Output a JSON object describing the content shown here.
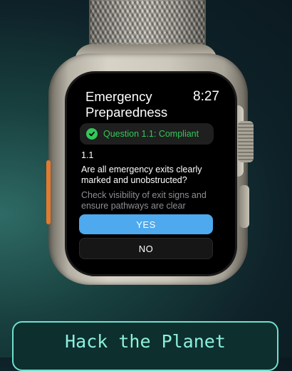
{
  "watch": {
    "title_line1": "Emergency",
    "title_line2": "Preparedness",
    "time": "8:27",
    "status_text": "Question 1.1: Compliant",
    "question_number": "1.1",
    "question_text": "Are all emergency exits clearly marked and unobstructed?",
    "hint_text": "Check visibility of exit signs and ensure pathways are clear",
    "yes_label": "YES",
    "no_label": "NO"
  },
  "banner": {
    "text": "Hack the Planet"
  },
  "colors": {
    "accent_blue": "#4ea9ee",
    "compliant_green": "#34c759",
    "banner_text": "#8ef0dc"
  }
}
